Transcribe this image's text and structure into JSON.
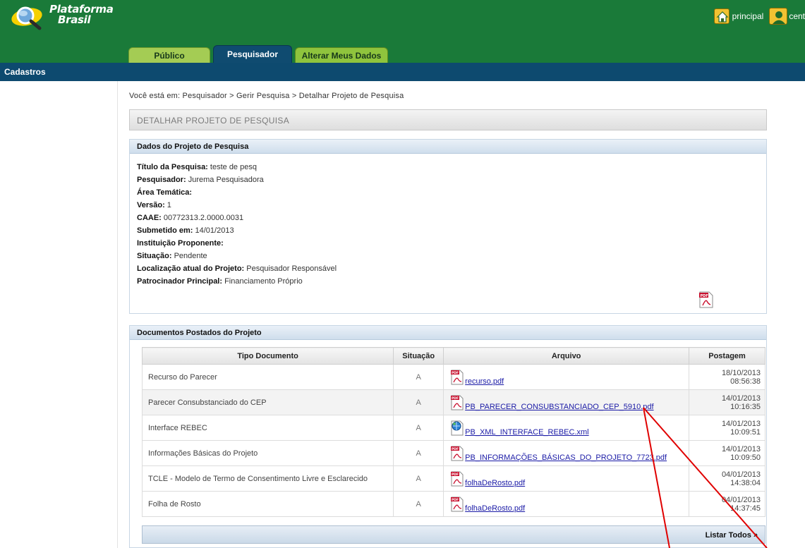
{
  "header": {
    "logo_line1": "Plataforma",
    "logo_line2": "Brasil",
    "home_link": "principal",
    "user_link_cut": "cent"
  },
  "tabs": [
    {
      "label": "Público"
    },
    {
      "label": "Pesquisador"
    },
    {
      "label": "Alterar Meus Dados"
    }
  ],
  "nav": {
    "label": "Cadastros"
  },
  "breadcrumb": "Você está em: Pesquisador > Gerir Pesquisa > Detalhar Projeto de Pesquisa",
  "page_title": "DETALHAR PROJETO DE PESQUISA",
  "dados": {
    "title": "Dados do Projeto de Pesquisa",
    "fields": [
      {
        "label": "Título da Pesquisa:",
        "value": " teste de pesq"
      },
      {
        "label": "Pesquisador:",
        "value": " Jurema Pesquisadora"
      },
      {
        "label": "Área Temática:",
        "value": ""
      },
      {
        "label": "Versão:",
        "value": " 1"
      },
      {
        "label": "CAAE:",
        "value": " 00772313.2.0000.0031"
      },
      {
        "label": "Submetido em:",
        "value": " 14/01/2013"
      },
      {
        "label": "Instituição Proponente:",
        "value": ""
      },
      {
        "label": "Situação:",
        "value": " Pendente"
      },
      {
        "label": "Localização atual do Projeto:",
        "value": " Pesquisador Responsável"
      },
      {
        "label": "Patrocinador Principal:",
        "value": "  Financiamento Próprio"
      }
    ]
  },
  "docs": {
    "title": "Documentos Postados do Projeto",
    "columns": [
      "Tipo Documento",
      "Situação",
      "Arquivo",
      "Postagem"
    ],
    "rows": [
      {
        "tipo": "Recurso do Parecer",
        "situacao": "A",
        "arquivo": "recurso.pdf",
        "icon": "pdf",
        "postagem": "18/10/2013 08:56:38"
      },
      {
        "tipo": "Parecer Consubstanciado do CEP",
        "situacao": "A",
        "arquivo": "PB_PARECER_CONSUBSTANCIADO_CEP_5910.pdf",
        "icon": "pdf",
        "postagem": "14/01/2013 10:16:35"
      },
      {
        "tipo": "Interface REBEC",
        "situacao": "A",
        "arquivo": "PB_XML_INTERFACE_REBEC.xml",
        "icon": "xml",
        "postagem": "14/01/2013 10:09:51"
      },
      {
        "tipo": "Informações Básicas do Projeto",
        "situacao": "A",
        "arquivo": "PB_INFORMAÇÕES_BÁSICAS_DO_PROJETO_7723.pdf",
        "icon": "pdf",
        "postagem": "14/01/2013 10:09:50"
      },
      {
        "tipo": "TCLE - Modelo de Termo de Consentimento Livre e Esclarecido",
        "situacao": "A",
        "arquivo": "folhaDeRosto.pdf",
        "icon": "pdf",
        "postagem": "04/01/2013 14:38:04"
      },
      {
        "tipo": "Folha de Rosto",
        "situacao": "A",
        "arquivo": "folhaDeRosto.pdf",
        "icon": "pdf",
        "postagem": "04/01/2013 14:37:45"
      }
    ],
    "listar_todos": "Listar Todos »"
  },
  "colors": {
    "header_green": "#1a7a39",
    "nav_blue": "#0d4a6f",
    "link_blue": "#1a1aa6",
    "annotation_red": "#e00000"
  }
}
